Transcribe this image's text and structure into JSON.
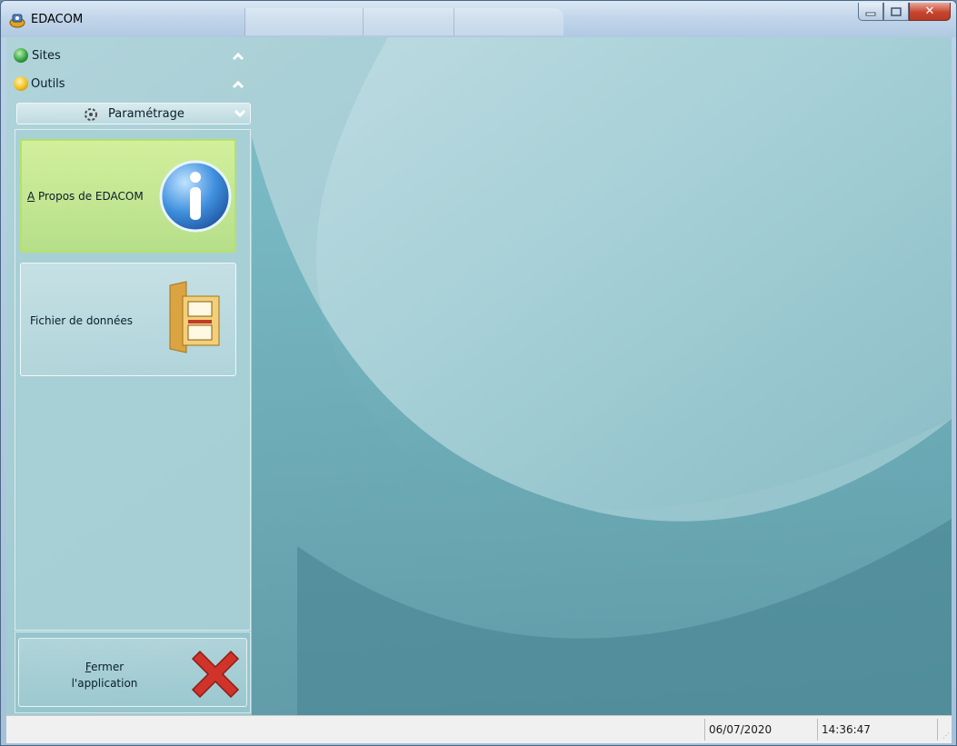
{
  "window": {
    "title": "EDACOM"
  },
  "sidebar": {
    "sections": [
      {
        "label": "Sites",
        "icon": "green-globe-icon"
      },
      {
        "label": "Outils",
        "icon": "tools-icon"
      }
    ],
    "subsection": {
      "label": "Paramétrage",
      "icon": "settings-gear-icon"
    },
    "tiles": [
      {
        "label_accel": "A",
        "label_rest": " Propos de EDACOM",
        "icon": "info-icon"
      },
      {
        "label": "Fichier de données",
        "icon": "folder-files-icon"
      }
    ],
    "exit": {
      "line1_accel": "F",
      "line1_rest": "ermer",
      "line2": "l'application",
      "icon": "red-x-icon"
    }
  },
  "statusbar": {
    "date": "06/07/2020",
    "time": "14:36:47"
  },
  "colors": {
    "background_teal": "#6fb0bc",
    "tile_highlight": "#c8ec8c",
    "close_red": "#d0332a"
  }
}
